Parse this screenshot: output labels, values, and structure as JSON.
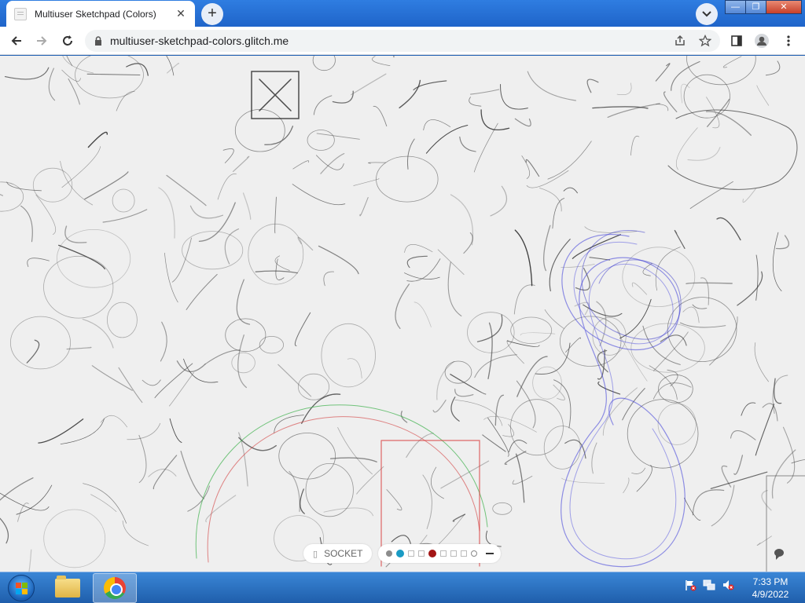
{
  "browser": {
    "tab_title": "Multiuser Sketchpad (Colors)",
    "tab_close": "✕",
    "new_tab": "+",
    "url": "multiuser-sketchpad-colors.glitch.me",
    "window_buttons": {
      "minimize": "—",
      "maximize": "❐",
      "close": "✕"
    }
  },
  "app": {
    "socket_icon": "▯",
    "socket_label": "SOCKET",
    "palette": [
      {
        "color": "#8c8c8c",
        "shape": "dot"
      },
      {
        "color": "#1a9bc4",
        "shape": "dot-big",
        "selected": true
      },
      {
        "color": "#ffffff",
        "shape": "square"
      },
      {
        "color": "#ffffff",
        "shape": "square"
      },
      {
        "color": "#a31515",
        "shape": "dot-big"
      },
      {
        "color": "#ffffff",
        "shape": "square"
      },
      {
        "color": "#ffffff",
        "shape": "square"
      },
      {
        "color": "#ffffff",
        "shape": "square"
      },
      {
        "color": "#ffffff",
        "shape": "ring"
      }
    ]
  },
  "taskbar": {
    "time": "7:33 PM",
    "date": "4/9/2022"
  }
}
